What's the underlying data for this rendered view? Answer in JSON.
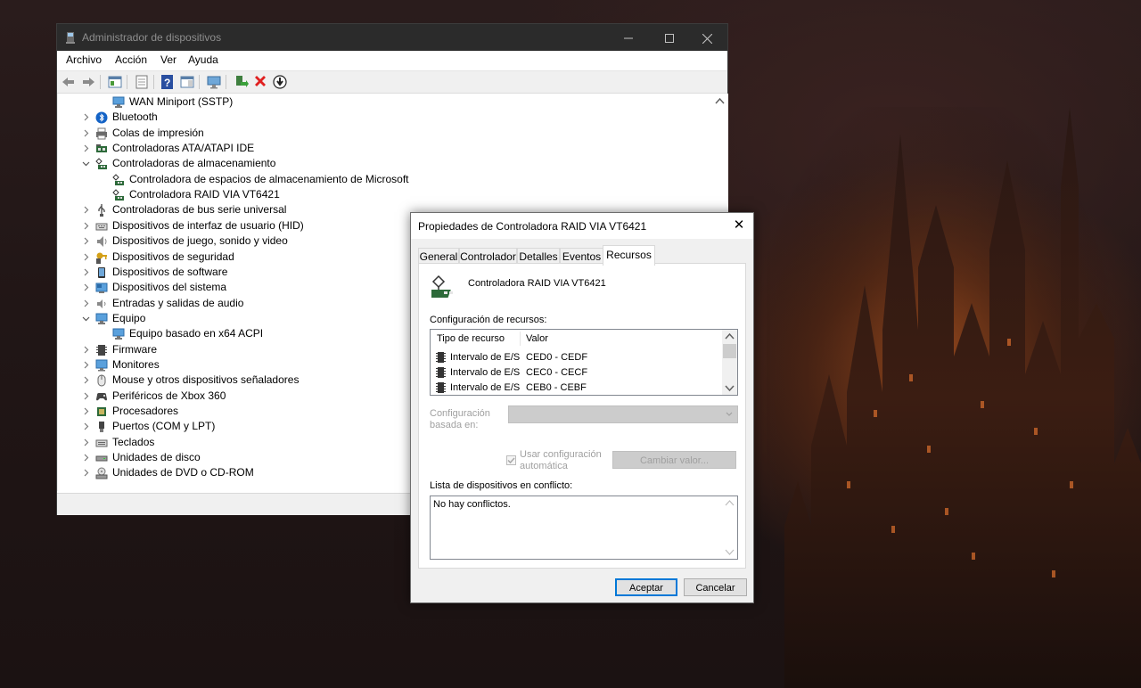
{
  "device_manager": {
    "title": "Administrador de dispositivos",
    "menu": [
      "Archivo",
      "Acción",
      "Ver",
      "Ayuda"
    ],
    "tree": [
      {
        "label": "WAN Miniport (SSTP)",
        "icon": "network-adapter-icon",
        "level": 1,
        "expander": "none"
      },
      {
        "label": "Bluetooth",
        "icon": "bluetooth-icon",
        "level": 0,
        "expander": "collapsed"
      },
      {
        "label": "Colas de impresión",
        "icon": "printer-icon",
        "level": 0,
        "expander": "collapsed"
      },
      {
        "label": "Controladoras ATA/ATAPI IDE",
        "icon": "ide-controller-icon",
        "level": 0,
        "expander": "collapsed"
      },
      {
        "label": "Controladoras de almacenamiento",
        "icon": "storage-controller-icon",
        "level": 0,
        "expander": "expanded"
      },
      {
        "label": "Controladora de espacios de almacenamiento de Microsoft",
        "icon": "storage-controller-icon",
        "level": 1,
        "expander": "none"
      },
      {
        "label": "Controladora RAID VIA VT6421",
        "icon": "storage-controller-icon",
        "level": 1,
        "expander": "none"
      },
      {
        "label": "Controladoras de bus serie universal",
        "icon": "usb-icon",
        "level": 0,
        "expander": "collapsed"
      },
      {
        "label": "Dispositivos de interfaz de usuario (HID)",
        "icon": "hid-icon",
        "level": 0,
        "expander": "collapsed"
      },
      {
        "label": "Dispositivos de juego, sonido y video",
        "icon": "speaker-icon",
        "level": 0,
        "expander": "collapsed"
      },
      {
        "label": "Dispositivos de seguridad",
        "icon": "security-key-icon",
        "level": 0,
        "expander": "collapsed"
      },
      {
        "label": "Dispositivos de software",
        "icon": "software-device-icon",
        "level": 0,
        "expander": "collapsed"
      },
      {
        "label": "Dispositivos del sistema",
        "icon": "system-device-icon",
        "level": 0,
        "expander": "collapsed"
      },
      {
        "label": "Entradas y salidas de audio",
        "icon": "audio-io-icon",
        "level": 0,
        "expander": "collapsed"
      },
      {
        "label": "Equipo",
        "icon": "computer-icon",
        "level": 0,
        "expander": "expanded"
      },
      {
        "label": "Equipo basado en x64 ACPI",
        "icon": "computer-icon",
        "level": 1,
        "expander": "none"
      },
      {
        "label": "Firmware",
        "icon": "firmware-icon",
        "level": 0,
        "expander": "collapsed"
      },
      {
        "label": "Monitores",
        "icon": "monitor-icon",
        "level": 0,
        "expander": "collapsed"
      },
      {
        "label": "Mouse y otros dispositivos señaladores",
        "icon": "mouse-icon",
        "level": 0,
        "expander": "collapsed"
      },
      {
        "label": "Periféricos de Xbox 360",
        "icon": "gamepad-icon",
        "level": 0,
        "expander": "collapsed"
      },
      {
        "label": "Procesadores",
        "icon": "processor-icon",
        "level": 0,
        "expander": "collapsed"
      },
      {
        "label": "Puertos (COM y LPT)",
        "icon": "port-icon",
        "level": 0,
        "expander": "collapsed"
      },
      {
        "label": "Teclados",
        "icon": "keyboard-icon",
        "level": 0,
        "expander": "collapsed"
      },
      {
        "label": "Unidades de disco",
        "icon": "disk-drive-icon",
        "level": 0,
        "expander": "collapsed"
      },
      {
        "label": "Unidades de DVD o CD-ROM",
        "icon": "dvd-drive-icon",
        "level": 0,
        "expander": "collapsed"
      }
    ]
  },
  "properties_dialog": {
    "title": "Propiedades de Controladora RAID VIA VT6421",
    "close_glyph": "✕",
    "tabs": [
      "General",
      "Controlador",
      "Detalles",
      "Eventos",
      "Recursos"
    ],
    "active_tab": "Recursos",
    "device_name": "Controladora RAID VIA VT6421",
    "resource_settings_label": "Configuración de recursos:",
    "resource_columns": [
      "Tipo de recurso",
      "Valor"
    ],
    "resources": [
      {
        "type": "Intervalo de E/S",
        "value": "CED0 - CEDF"
      },
      {
        "type": "Intervalo de E/S",
        "value": "CEC0 - CECF"
      },
      {
        "type": "Intervalo de E/S",
        "value": "CEB0 - CEBF"
      }
    ],
    "setting_based_on_label": "Configuración basada en:",
    "setting_based_on_line1": "Configuración",
    "setting_based_on_line2": "basada en:",
    "use_auto_label_line1": "Usar configuración",
    "use_auto_label_line2": "automática",
    "use_auto_checked": true,
    "change_setting_button": "Cambiar valor...",
    "conflict_list_label": "Lista de dispositivos en conflicto:",
    "conflict_text": "No hay conflictos.",
    "ok_button": "Aceptar",
    "cancel_button": "Cancelar"
  },
  "colors": {
    "title_bar_dark": "#2b2b2b",
    "accent": "#0078d7"
  }
}
